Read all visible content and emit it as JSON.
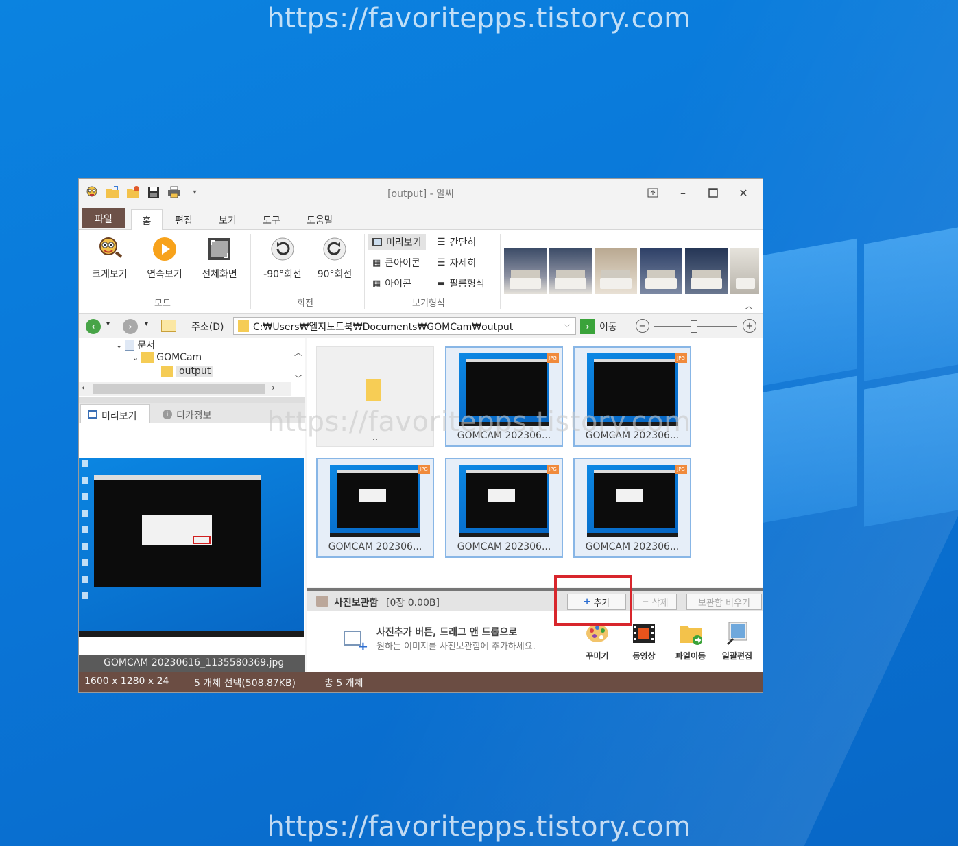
{
  "watermark": "https://favoritepps.tistory.com",
  "window": {
    "title": "[output] - 알씨"
  },
  "menu_tabs": [
    "파일",
    "홈",
    "편집",
    "보기",
    "도구",
    "도움말"
  ],
  "ribbon": {
    "mode": {
      "label": "모드",
      "buttons": [
        "크게보기",
        "연속보기",
        "전체화면"
      ]
    },
    "rotate": {
      "label": "회전",
      "buttons": [
        "-90°회전",
        "90°회전"
      ]
    },
    "view": {
      "label": "보기형식",
      "options": [
        "미리보기",
        "간단히",
        "큰아이콘",
        "자세히",
        "아이콘",
        "필름형식"
      ],
      "selected": "미리보기"
    }
  },
  "address": {
    "label": "주소(D)",
    "path": "C:₩Users₩엘지노트북₩Documents₩GOMCam₩output",
    "go_label": "이동",
    "zoom_level": 0.48
  },
  "tree": {
    "items": [
      "문서",
      "GOMCam",
      "output"
    ],
    "selected": "output"
  },
  "preview_tabs": [
    "미리보기",
    "디카정보"
  ],
  "preview_caption": "GOMCAM  20230616_1135580369.jpg",
  "files": {
    "up_label": "..",
    "items": [
      {
        "name": "GOMCAM 202306..."
      },
      {
        "name": "GOMCAM 202306..."
      },
      {
        "name": "GOMCAM 202306..."
      },
      {
        "name": "GOMCAM 202306..."
      },
      {
        "name": "GOMCAM 202306..."
      }
    ],
    "badge": "JPG"
  },
  "album": {
    "label": "사진보관함",
    "count": "[0장 0.00B]",
    "add_label": "추가",
    "delete_label": "삭제",
    "clear_label": "보관함 비우기",
    "hint_title": "사진추가 버튼, 드래그 앤 드롭으로",
    "hint_body": "원하는 이미지를 사진보관함에 추가하세요.",
    "tools": [
      "꾸미기",
      "동영상",
      "파일이동",
      "일괄편집"
    ]
  },
  "status": {
    "dimensions": "1600 x 1280 x 24",
    "selection": "5 개체 선택(508.87KB)",
    "total": "총 5 개체"
  },
  "colors": {
    "file_tab": "#6d5148",
    "status_bar": "#6b4d43",
    "highlight": "#d8262c",
    "selection_border": "#88b6e6"
  }
}
